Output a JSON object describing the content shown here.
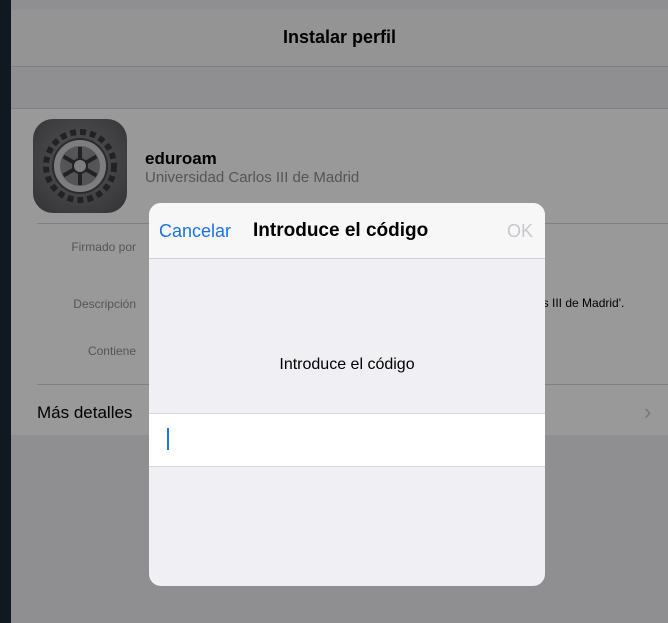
{
  "nav": {
    "title": "Instalar perfil"
  },
  "profile": {
    "name": "eduroam",
    "organization": "Universidad Carlos III de Madrid",
    "icon": "settings-gear-icon"
  },
  "details": {
    "signed_by_label": "Firmado por",
    "description_label": "Descripción",
    "description_value_partial": "os III de Madrid'.",
    "contains_label": "Contiene",
    "more_details": "Más detalles",
    "chevron": "›"
  },
  "modal": {
    "cancel_label": "Cancelar",
    "title": "Introduce el código",
    "ok_label": "OK",
    "prompt": "Introduce el código",
    "input_value": ""
  },
  "colors": {
    "accent": "#1a73e8",
    "disabled": "#c7c7cc",
    "secondary_text": "#8e8e93",
    "grouped_background": "#efeff4"
  }
}
